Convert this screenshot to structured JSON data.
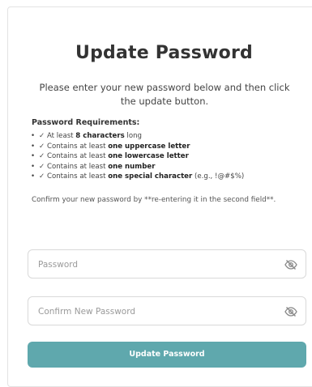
{
  "page": {
    "title": "Update Password",
    "subtitle": "Please enter your new password below and then click the update button."
  },
  "requirements": {
    "title": "Password Requirements:",
    "items": [
      {
        "check": "✓",
        "prefix": "At least ",
        "bold": "8 characters",
        "suffix": " long"
      },
      {
        "check": "✓",
        "prefix": "Contains at least ",
        "bold": "one uppercase letter",
        "suffix": ""
      },
      {
        "check": "✓",
        "prefix": "Contains at least ",
        "bold": "one lowercase letter",
        "suffix": ""
      },
      {
        "check": "✓",
        "prefix": "Contains at least ",
        "bold": "one number",
        "suffix": ""
      },
      {
        "check": "✓",
        "prefix": "Contains at least ",
        "bold": "one special character",
        "suffix": " (e.g., !@#$%)"
      }
    ],
    "confirm_note": "Confirm your new password by **re-entering it in the second field**."
  },
  "form": {
    "password": {
      "placeholder": "Password",
      "value": "",
      "icon": "eye-slash-icon"
    },
    "confirm": {
      "placeholder": "Confirm New Password",
      "value": "",
      "icon": "eye-slash-icon"
    },
    "submit_label": "Update Password"
  },
  "colors": {
    "accent": "#5fa8ad",
    "text": "#333333",
    "border": "#d9d9d9"
  }
}
